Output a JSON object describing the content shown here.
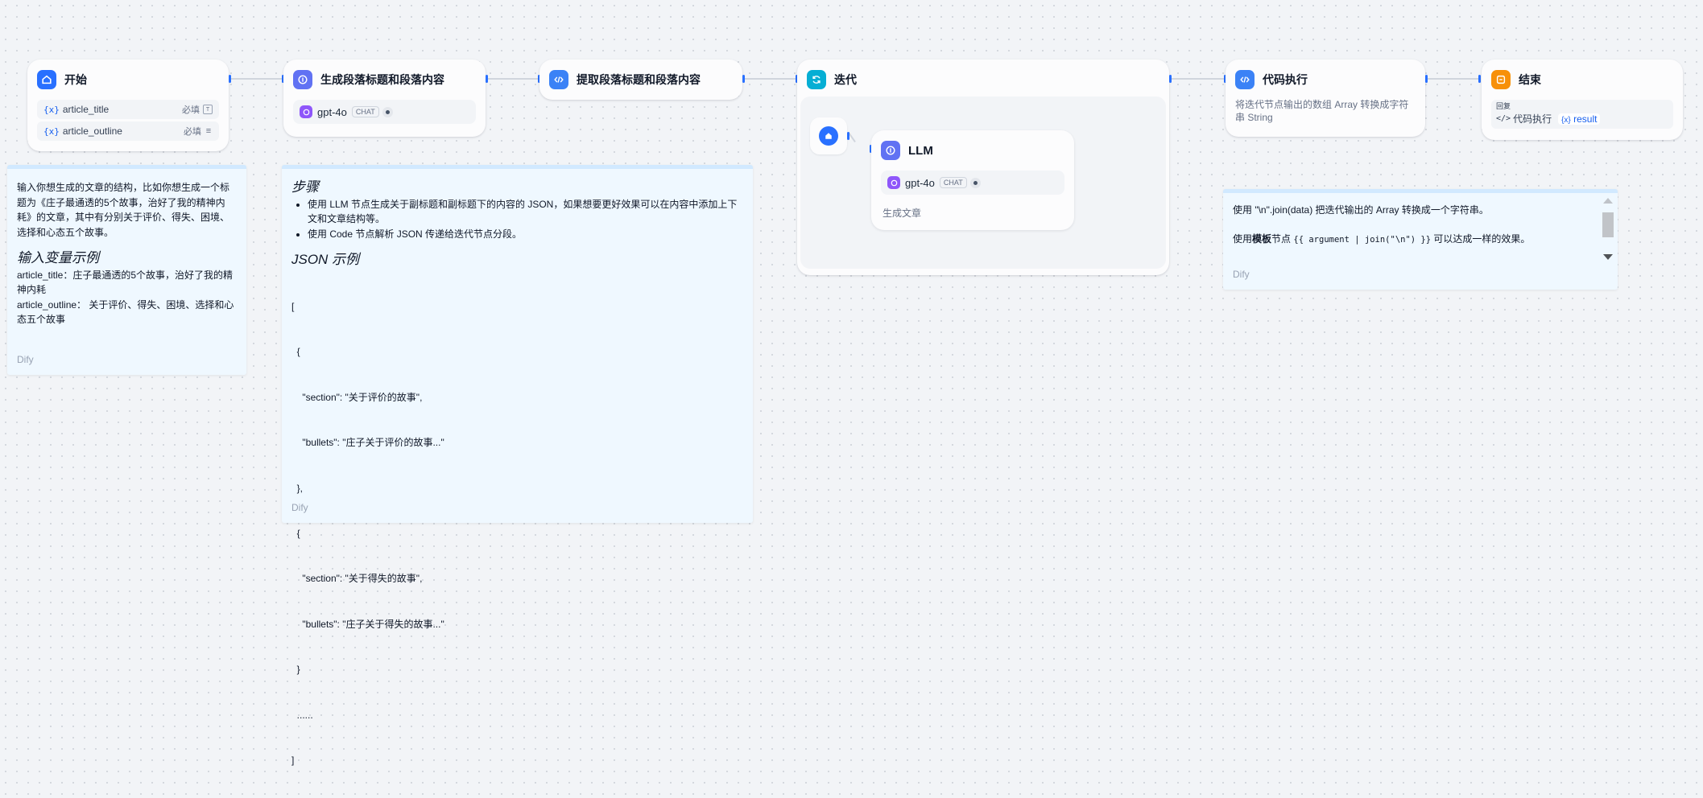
{
  "nodes": {
    "start": {
      "title": "开始",
      "variables": [
        {
          "name": "article_title",
          "required": "必填",
          "x": "{x}"
        },
        {
          "name": "article_outline",
          "required": "必填",
          "x": "{x}"
        }
      ]
    },
    "gen": {
      "title": "生成段落标题和段落内容",
      "model": "gpt-4o",
      "mode": "CHAT"
    },
    "extract": {
      "title": "提取段落标题和段落内容"
    },
    "iteration": {
      "title": "迭代",
      "llm": {
        "title": "LLM",
        "model": "gpt-4o",
        "mode": "CHAT",
        "desc": "生成文章"
      }
    },
    "code": {
      "title": "代码执行",
      "desc": "将迭代节点输出的数组 Array 转换成字符串 String"
    },
    "end": {
      "title": "结束",
      "output_label": "回复",
      "source": "代码执行",
      "var_x": "{x}",
      "var": "result"
    }
  },
  "notes": {
    "note1": {
      "intro": "输入你想生成的文章的结构，比如你想生成一个标题为《庄子最通透的5个故事，治好了我的精神内耗》的文章，其中有分别关于评价、得失、困境、选择和心态五个故事。",
      "heading": "输入变量示例",
      "line1": "article_title：庄子最通透的5个故事，治好了我的精神内耗",
      "line2": "article_outline： 关于评价、得失、困境、选择和心态五个故事",
      "footer": "Dify"
    },
    "note2": {
      "heading": "步骤",
      "bullet1": "使用 LLM 节点生成关于副标题和副标题下的内容的 JSON，如果想要更好效果可以在内容中添加上下文和文章结构等。",
      "bullet2": "使用 Code 节点解析 JSON 传递给迭代节点分段。",
      "heading2": "JSON 示例",
      "json_lines": [
        "[",
        "  {",
        "    \"section\": \"关于评价的故事\",",
        "    \"bullets\": \"庄子关于评价的故事...\"",
        "  },",
        "  {",
        "    \"section\": \"关于得失的故事\",",
        "    \"bullets\": \"庄子关于得失的故事...\"",
        "  }",
        "  ......",
        "]"
      ],
      "footer": "Dify"
    },
    "note3": {
      "line1": "使用 \"\\n\".join(data) 把迭代输出的 Array 转换成一个字符串。",
      "line2_prefix": "使用",
      "line2_bold": "模板",
      "line2_mid": "节点",
      "line2_code": "{{ argument | join(\"\\n\") }}",
      "line2_suffix": " 可以达成一样的效果。",
      "footer": "Dify"
    }
  }
}
